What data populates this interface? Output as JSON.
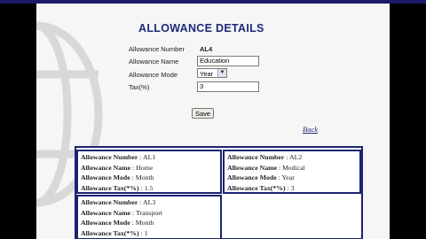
{
  "form": {
    "title": "ALLOWANCE DETAILS",
    "fields": {
      "number_label": "Allowance Number",
      "number_value": "AL4",
      "name_label": "Allowance Name",
      "name_value": "Education",
      "mode_label": "Allowance Mode",
      "mode_value": "Year",
      "tax_label": "Tax(%)",
      "tax_value": "3"
    },
    "save_label": "Save",
    "back_label": "Back"
  },
  "records": [
    {
      "number_label": "Allowance Number",
      "number": "AL1",
      "name_label": "Allowance Name",
      "name": "Home",
      "mode_label": "Allowance Mode",
      "mode": "Month",
      "tax_label": "Allowance Tax(*%)",
      "tax": "1.5"
    },
    {
      "number_label": "Allowance Number",
      "number": "AL2",
      "name_label": "Allowance Name",
      "name": "Medical",
      "mode_label": "Allowance Mode",
      "mode": "Year",
      "tax_label": "Allowance Tax(*%)",
      "tax": "3"
    },
    {
      "number_label": "Allowance Number",
      "number": "AL3",
      "name_label": "Allowance Name",
      "name": "Transport",
      "mode_label": "Allowance Mode",
      "mode": "Month",
      "tax_label": "Allowance Tax(*%)",
      "tax": "1"
    }
  ],
  "colors": {
    "frame": "#000000",
    "heading": "#1d2a7a",
    "border": "#1c2470",
    "panel": "#f6f6f6"
  }
}
